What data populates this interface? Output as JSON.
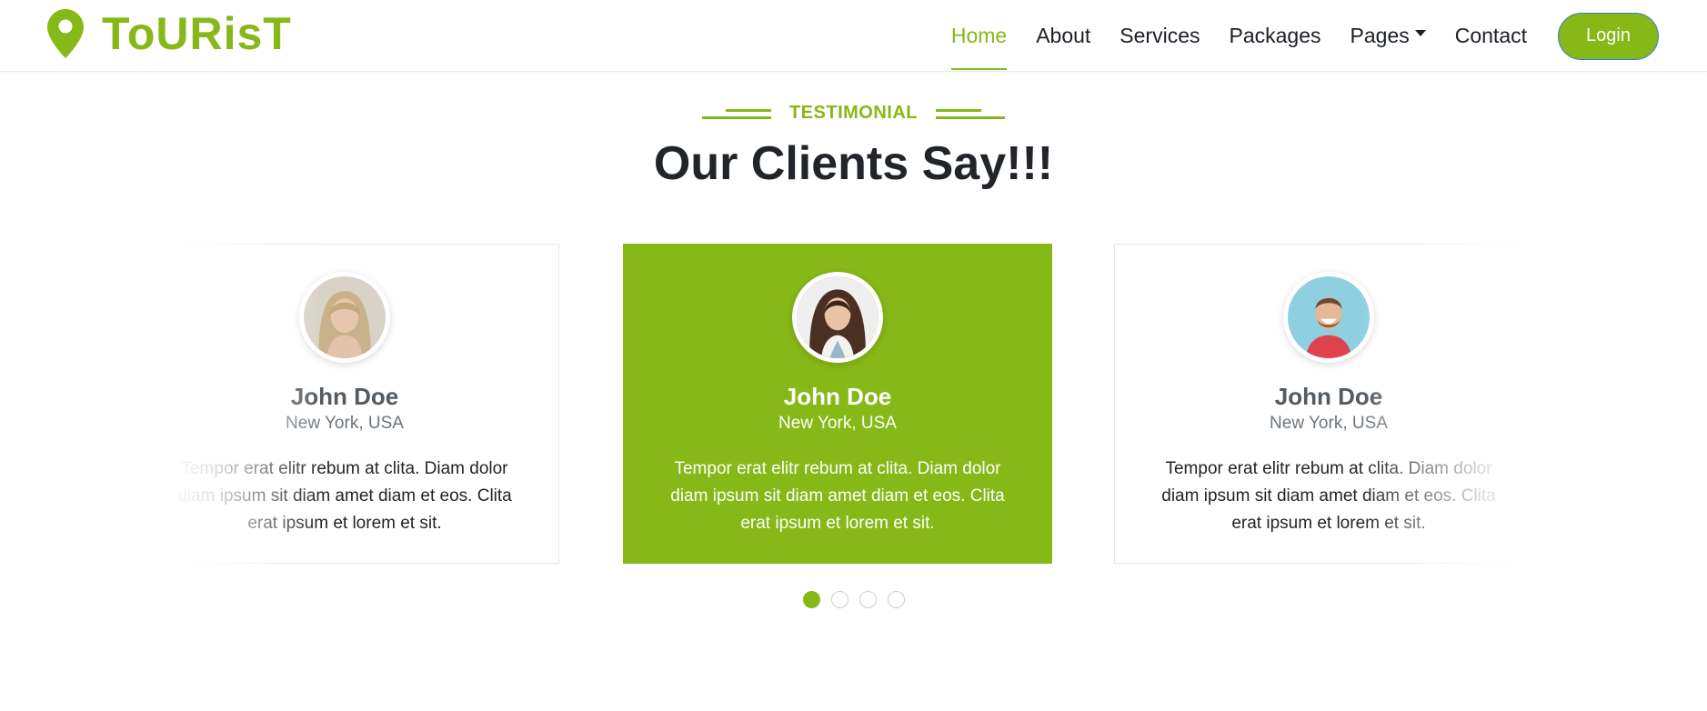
{
  "brand": {
    "name": "ToURisT",
    "icon": "map-pin-icon",
    "color": "#86b817"
  },
  "nav": {
    "items": [
      {
        "label": "Home",
        "active": true
      },
      {
        "label": "About"
      },
      {
        "label": "Services"
      },
      {
        "label": "Packages"
      },
      {
        "label": "Pages",
        "dropdown": true
      },
      {
        "label": "Contact"
      }
    ],
    "login_label": "Login"
  },
  "section": {
    "label": "TESTIMONIAL",
    "title": "Our Clients Say!!!"
  },
  "testimonials": [
    {
      "name": "John Doe",
      "location": "New York, USA",
      "quote": "Tempor erat elitr rebum at clita. Diam dolor diam ipsum sit diam amet diam et eos. Clita erat ipsum et lorem et sit.",
      "avatar": "woman-blonde-avatar"
    },
    {
      "name": "John Doe",
      "location": "New York, USA",
      "quote": "Tempor erat elitr rebum at clita. Diam dolor diam ipsum sit diam amet diam et eos. Clita erat ipsum et lorem et sit.",
      "avatar": "woman-brunette-avatar",
      "active": true
    },
    {
      "name": "John Doe",
      "location": "New York, USA",
      "quote": "Tempor erat elitr rebum at clita. Diam dolor diam ipsum sit diam amet diam et eos. Clita erat ipsum et lorem et sit.",
      "avatar": "man-laughing-avatar"
    }
  ],
  "pagination": {
    "count": 4,
    "active_index": 0
  },
  "colors": {
    "accent": "#86b817",
    "text": "#212529",
    "muted": "#6c757d"
  }
}
